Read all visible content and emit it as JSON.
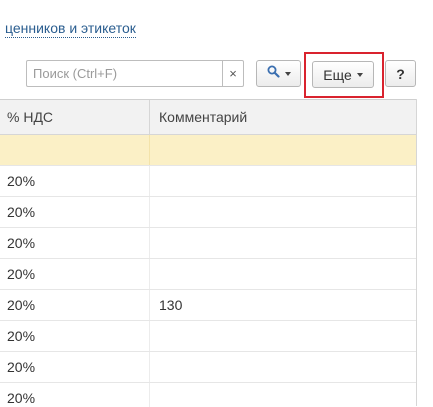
{
  "header": {
    "link_text": "ценников и этикеток"
  },
  "toolbar": {
    "search_placeholder": "Поиск (Ctrl+F)",
    "clear_glyph": "×",
    "more_label": "Еще",
    "help_label": "?"
  },
  "table": {
    "columns": [
      "% НДС",
      "Комментарий"
    ],
    "rows": [
      {
        "vat": "",
        "comment": ""
      },
      {
        "vat": "20%",
        "comment": ""
      },
      {
        "vat": "20%",
        "comment": ""
      },
      {
        "vat": "20%",
        "comment": ""
      },
      {
        "vat": "20%",
        "comment": ""
      },
      {
        "vat": "20%",
        "comment": "130"
      },
      {
        "vat": "20%",
        "comment": ""
      },
      {
        "vat": "20%",
        "comment": ""
      },
      {
        "vat": "20%",
        "comment": ""
      }
    ]
  },
  "colors": {
    "link": "#2a5d8f",
    "selected_row": "#fbf0c6",
    "highlight_frame": "#d9232e",
    "search_icon": "#3b6fb0"
  }
}
